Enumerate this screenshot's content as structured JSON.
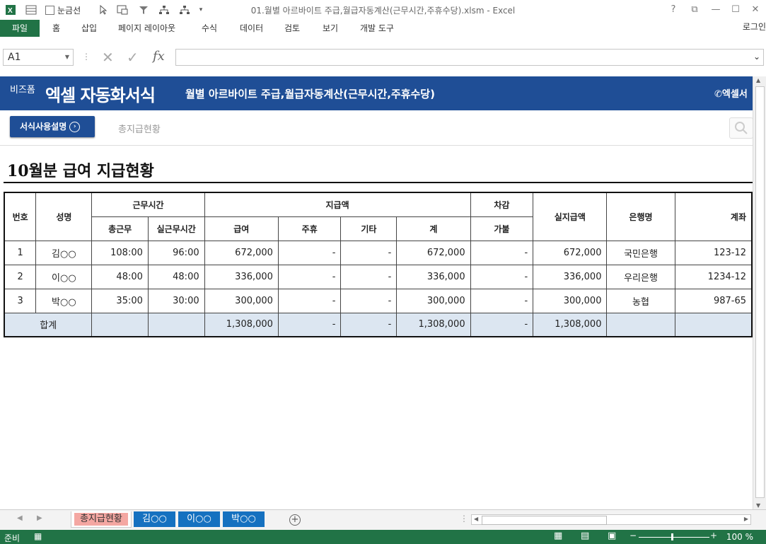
{
  "window": {
    "title": "01.월별 아르바이트 주급,월급자동계산(근무시간,주휴수당).xlsm - Excel",
    "gridlines_label": "눈금선",
    "help": "?",
    "restore": "⧉",
    "minimize": "—",
    "maximize": "☐",
    "close": "✕"
  },
  "ribbon": {
    "file": "파일",
    "tabs": [
      "홈",
      "삽입",
      "페이지 레이아웃",
      "수식",
      "데이터",
      "검토",
      "보기",
      "개발 도구"
    ],
    "login": "로그인"
  },
  "formula_bar": {
    "name_box": "A1",
    "fx": "fx",
    "value": ""
  },
  "banner": {
    "brand_small": "비즈폼",
    "brand_big": "엑셀 자동화서식",
    "title": "월별 아르바이트 주급,월급자동계산(근무시간,주휴수당)",
    "right": "엑셀서"
  },
  "toolbar": {
    "guide_button": "서식사용설명",
    "summary_link": "총지급현황"
  },
  "heading": "10월분 급여 지급현황",
  "table": {
    "headers": {
      "no": "번호",
      "name": "성명",
      "work_time": "근무시간",
      "total_work": "총근무",
      "actual_work": "실근무시간",
      "payment": "지급액",
      "salary": "급여",
      "weekly_holiday": "주휴",
      "other": "기타",
      "sum": "계",
      "deduction": "차감",
      "advance": "가불",
      "net_pay": "실지급액",
      "bank": "은행명",
      "account": "계좌"
    },
    "rows": [
      {
        "no": "1",
        "name": "김○○",
        "total_work": "108:00",
        "actual_work": "96:00",
        "salary": "672,000",
        "weekly_holiday": "-",
        "other": "-",
        "sum": "672,000",
        "advance": "-",
        "net_pay": "672,000",
        "bank": "국민은행",
        "account": "123-12"
      },
      {
        "no": "2",
        "name": "이○○",
        "total_work": "48:00",
        "actual_work": "48:00",
        "salary": "336,000",
        "weekly_holiday": "-",
        "other": "-",
        "sum": "336,000",
        "advance": "-",
        "net_pay": "336,000",
        "bank": "우리은행",
        "account": "1234-12"
      },
      {
        "no": "3",
        "name": "박○○",
        "total_work": "35:00",
        "actual_work": "30:00",
        "salary": "300,000",
        "weekly_holiday": "-",
        "other": "-",
        "sum": "300,000",
        "advance": "-",
        "net_pay": "300,000",
        "bank": "농협",
        "account": "987-65"
      }
    ],
    "total": {
      "label": "합계",
      "salary": "1,308,000",
      "weekly_holiday": "-",
      "other": "-",
      "sum": "1,308,000",
      "advance": "-",
      "net_pay": "1,308,000"
    }
  },
  "sheet_tabs": [
    "총지급현황",
    "김○○",
    "이○○",
    "박○○"
  ],
  "status": {
    "text": "준비",
    "zoom": "100 %"
  },
  "colors": {
    "excel_green": "#217346",
    "banner_blue": "#1f4e96",
    "tab_blue": "#1571c0",
    "total_row": "#dce6f1"
  }
}
